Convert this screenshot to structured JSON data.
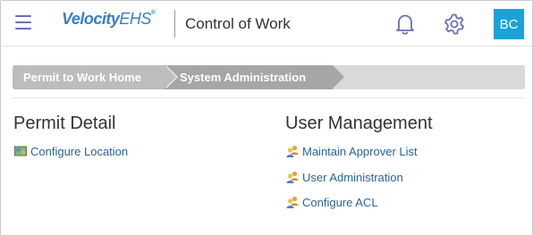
{
  "header": {
    "menu_icon": "hamburger-menu-icon",
    "logo_main": "Velocity",
    "logo_suffix": "EHS",
    "logo_mark": "®",
    "app_title": "Control of Work",
    "notifications_icon": "bell-icon",
    "settings_icon": "gear-icon",
    "avatar_initials": "BC",
    "colors": {
      "accent": "#6a6fb5",
      "avatar": "#1ba3d8",
      "logo": "#3a7fc1"
    }
  },
  "breadcrumb": {
    "items": [
      {
        "label": "Permit to Work Home"
      },
      {
        "label": "System Administration"
      }
    ]
  },
  "sections": {
    "permit_detail": {
      "title": "Permit Detail",
      "links": [
        {
          "label": "Configure Location",
          "icon": "map-icon"
        }
      ]
    },
    "user_management": {
      "title": "User Management",
      "links": [
        {
          "label": "Maintain Approver List",
          "icon": "users-icon"
        },
        {
          "label": "User Administration",
          "icon": "users-icon"
        },
        {
          "label": "Configure ACL",
          "icon": "users-icon"
        }
      ]
    }
  },
  "colors": {
    "link": "#2a6496"
  }
}
